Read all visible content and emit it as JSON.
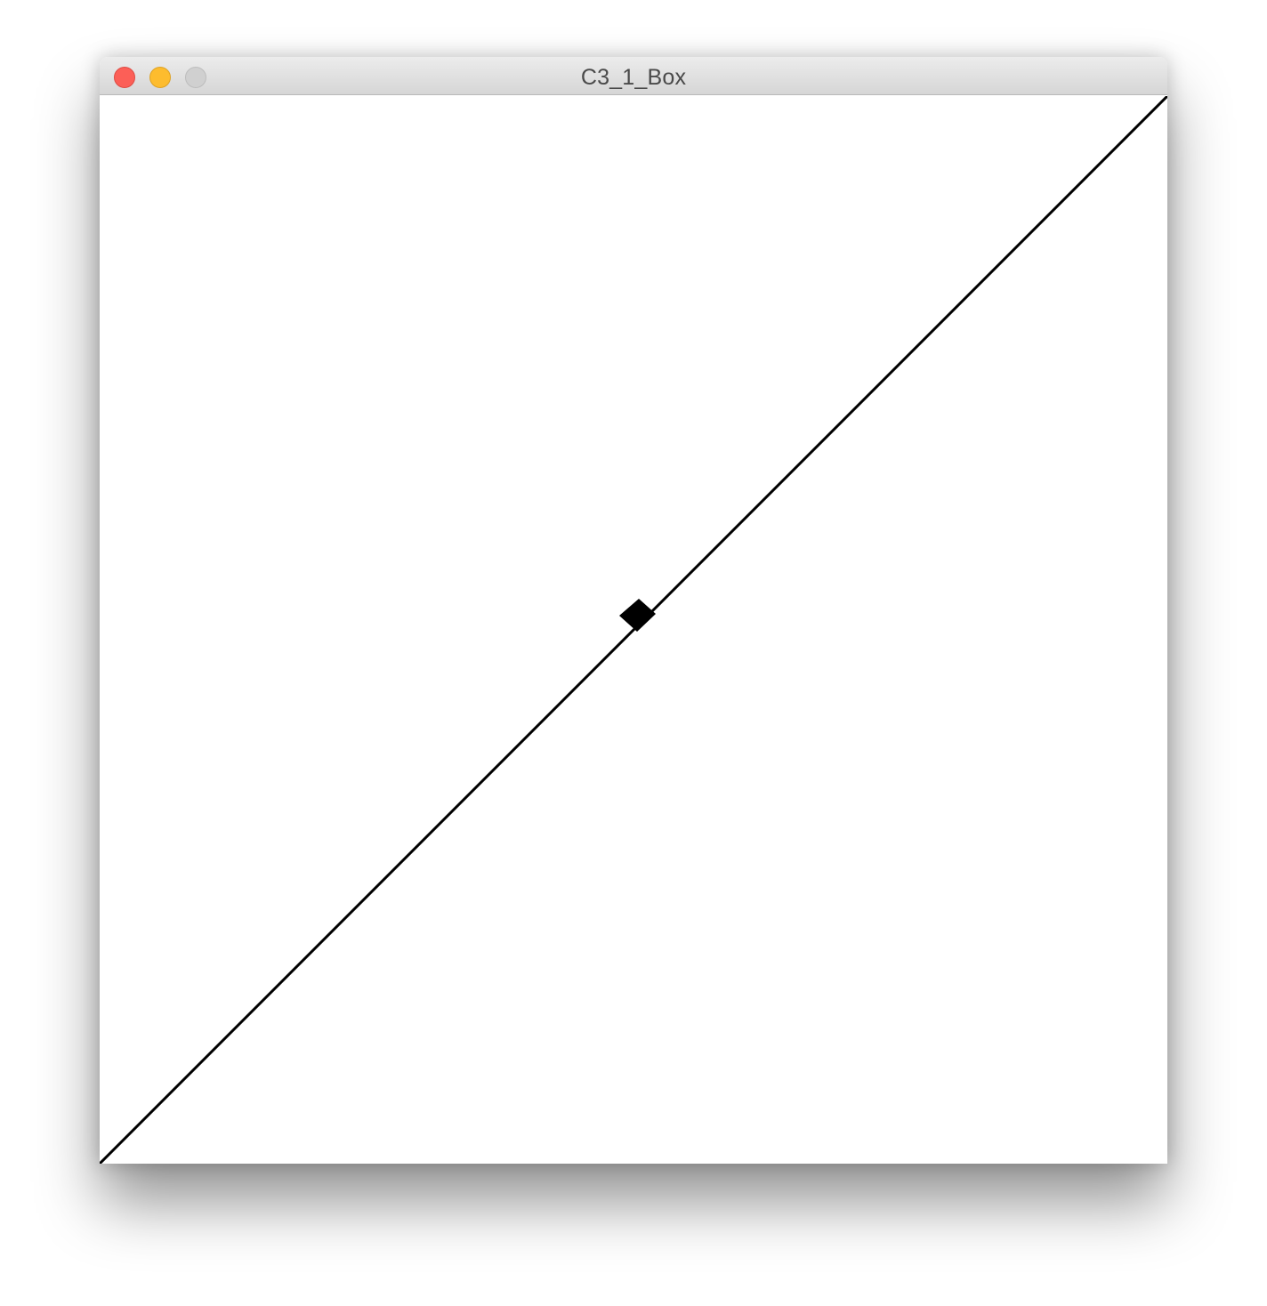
{
  "window": {
    "title": "C3_1_Box"
  },
  "icons": {
    "close": "close-traffic-light",
    "minimize": "minimize-traffic-light",
    "zoom": "zoom-traffic-light-disabled"
  },
  "colors": {
    "close": "#fc5f57",
    "minimize": "#fdbc2e",
    "zoom_disabled": "#d0d0d0",
    "drawing": "#000000",
    "background": "#ffffff"
  }
}
